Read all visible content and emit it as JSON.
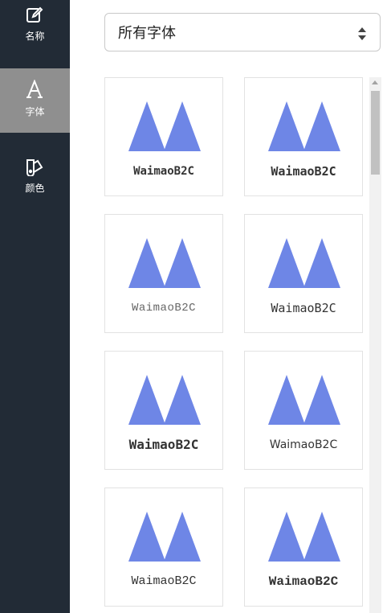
{
  "sidebar": {
    "items": [
      {
        "label": "名称",
        "icon": "edit-icon",
        "active": false
      },
      {
        "label": "字体",
        "icon": "font-icon",
        "active": true
      },
      {
        "label": "颜色",
        "icon": "palette-icon",
        "active": false
      }
    ]
  },
  "font_select": {
    "value": "所有字体"
  },
  "logo_color": "#6e86e6",
  "fonts": [
    {
      "sample": "WaimaoB2C"
    },
    {
      "sample": "WaimaoB2C"
    },
    {
      "sample": "WaimaoB2C"
    },
    {
      "sample": "WaimaoB2C"
    },
    {
      "sample": "WaimaoB2C"
    },
    {
      "sample": "WaimaoB2C"
    },
    {
      "sample": "WaimaoB2C"
    },
    {
      "sample": "WaimaoB2C"
    }
  ]
}
